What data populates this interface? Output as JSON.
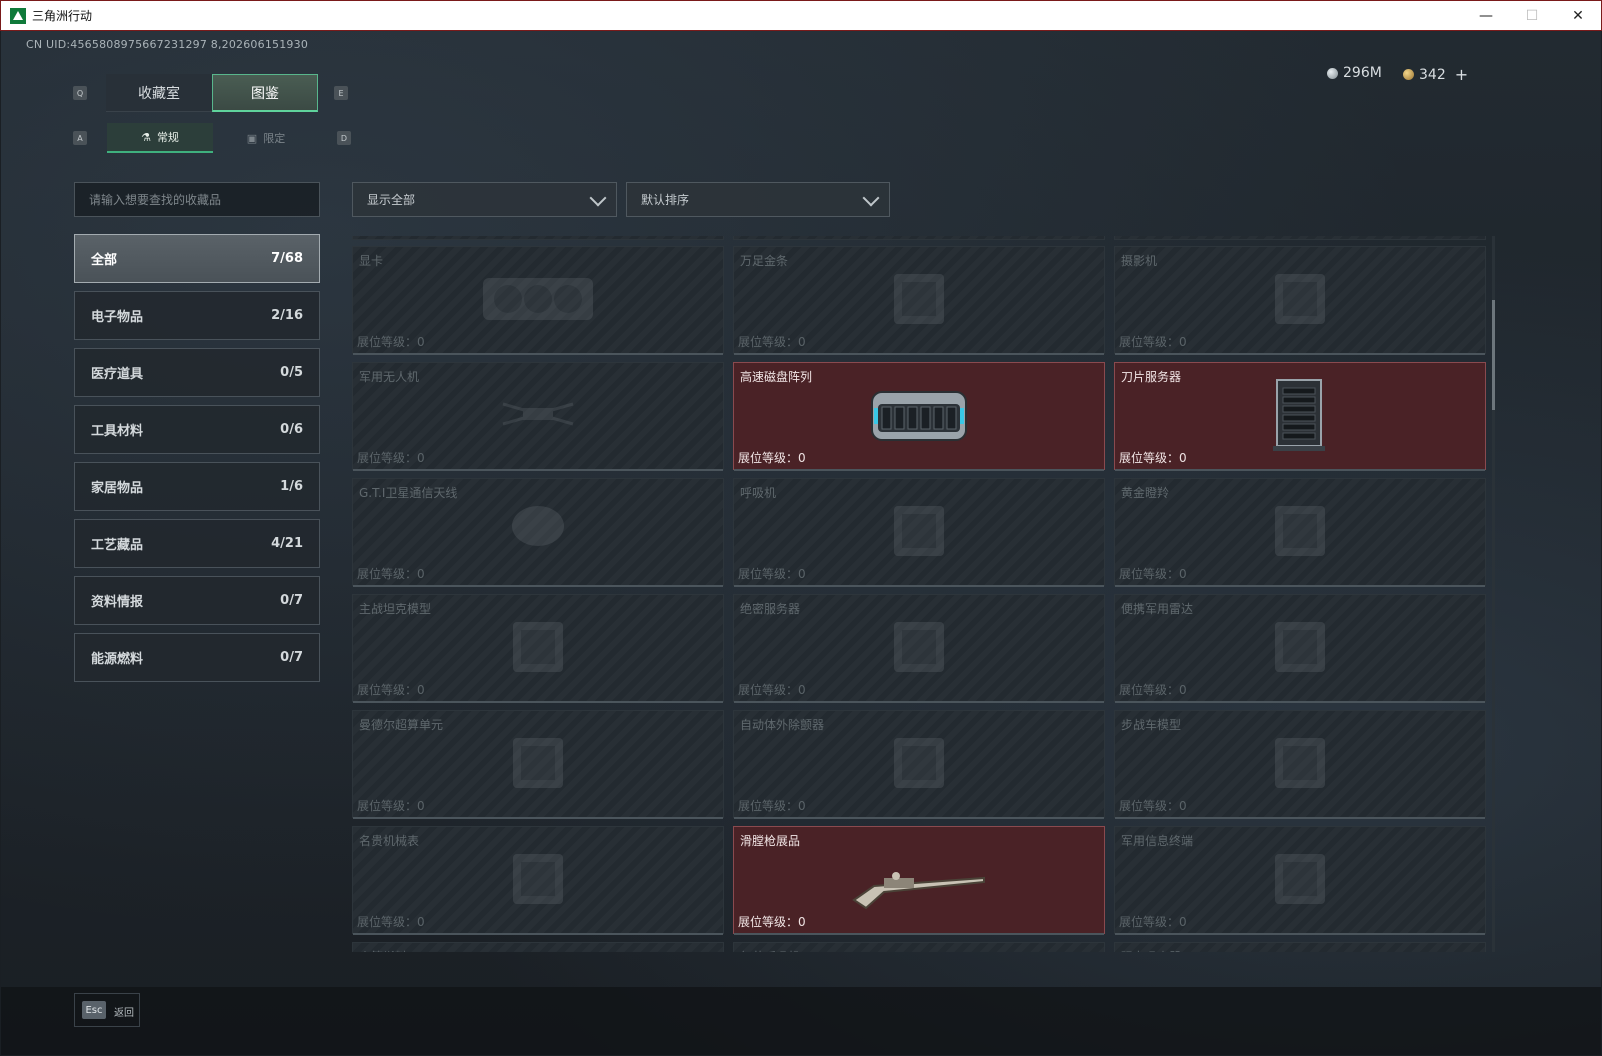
{
  "window": {
    "title": "三角洲行动",
    "minimize": "—",
    "maximize": "☐",
    "close": "✕"
  },
  "uid": "CN UID:4565808975667231297 8,202606151930",
  "currency": {
    "silver": "296M",
    "gold": "342",
    "add": "+"
  },
  "keys": {
    "q": "Q",
    "e": "E",
    "a": "A",
    "d": "D",
    "esc": "Esc"
  },
  "tabs": [
    {
      "label": "收藏室",
      "active": false
    },
    {
      "label": "图鉴",
      "active": true
    }
  ],
  "subtabs": [
    {
      "label": "常规",
      "icon": "flask-icon",
      "active": true
    },
    {
      "label": "限定",
      "icon": "image-icon",
      "active": false
    }
  ],
  "search": {
    "placeholder": "请输入想要查找的收藏品"
  },
  "filters": {
    "show": "显示全部",
    "sort": "默认排序"
  },
  "categories": [
    {
      "label": "全部",
      "count": "7/68",
      "active": true
    },
    {
      "label": "电子物品",
      "count": "2/16"
    },
    {
      "label": "医疗道具",
      "count": "0/5"
    },
    {
      "label": "工具材料",
      "count": "0/6"
    },
    {
      "label": "家居物品",
      "count": "1/6"
    },
    {
      "label": "工艺藏品",
      "count": "4/21"
    },
    {
      "label": "资料情报",
      "count": "0/7"
    },
    {
      "label": "能源燃料",
      "count": "0/7"
    }
  ],
  "level_prefix": "展位等级：",
  "items": [
    {
      "name": "显卡",
      "level": "0",
      "owned": false,
      "icon": "gpu-icon"
    },
    {
      "name": "万足金条",
      "level": "0",
      "owned": false,
      "icon": "gold-bar-icon"
    },
    {
      "name": "摄影机",
      "level": "0",
      "owned": false,
      "icon": "camera-icon"
    },
    {
      "name": "军用无人机",
      "level": "0",
      "owned": false,
      "icon": "drone-icon"
    },
    {
      "name": "高速磁盘阵列",
      "level": "0",
      "owned": true,
      "icon": "disk-array-icon"
    },
    {
      "name": "刀片服务器",
      "level": "0",
      "owned": true,
      "icon": "blade-server-icon"
    },
    {
      "name": "G.T.I卫星通信天线",
      "level": "0",
      "owned": false,
      "icon": "satellite-dish-icon"
    },
    {
      "name": "呼吸机",
      "level": "0",
      "owned": false,
      "icon": "ventilator-icon"
    },
    {
      "name": "黄金瞪羚",
      "level": "0",
      "owned": false,
      "icon": "gazelle-statue-icon"
    },
    {
      "name": "主战坦克模型",
      "level": "0",
      "owned": false,
      "icon": "tank-model-icon"
    },
    {
      "name": "绝密服务器",
      "level": "0",
      "owned": false,
      "icon": "server-icon"
    },
    {
      "name": "便携军用雷达",
      "level": "0",
      "owned": false,
      "icon": "radar-icon"
    },
    {
      "name": "曼德尔超算单元",
      "level": "0",
      "owned": false,
      "icon": "compute-unit-icon"
    },
    {
      "name": "自动体外除颤器",
      "level": "0",
      "owned": false,
      "icon": "defibrillator-icon"
    },
    {
      "name": "步战车模型",
      "level": "0",
      "owned": false,
      "icon": "ifv-model-icon"
    },
    {
      "name": "名贵机械表",
      "level": "0",
      "owned": false,
      "icon": "watch-icon"
    },
    {
      "name": "滑膛枪展品",
      "level": "0",
      "owned": true,
      "icon": "musket-icon"
    },
    {
      "name": "军用信息终端",
      "level": "0",
      "owned": false,
      "icon": "terminal-icon"
    },
    {
      "name": "火箭燃料",
      "level": "",
      "owned": false,
      "icon": "fuel-icon"
    },
    {
      "name": "复苏呼吸机",
      "level": "",
      "owned": false,
      "icon": "respirator-icon"
    },
    {
      "name": "强力吸尘器",
      "level": "",
      "owned": false,
      "icon": "vacuum-icon"
    }
  ],
  "footer": {
    "back": "返回"
  }
}
